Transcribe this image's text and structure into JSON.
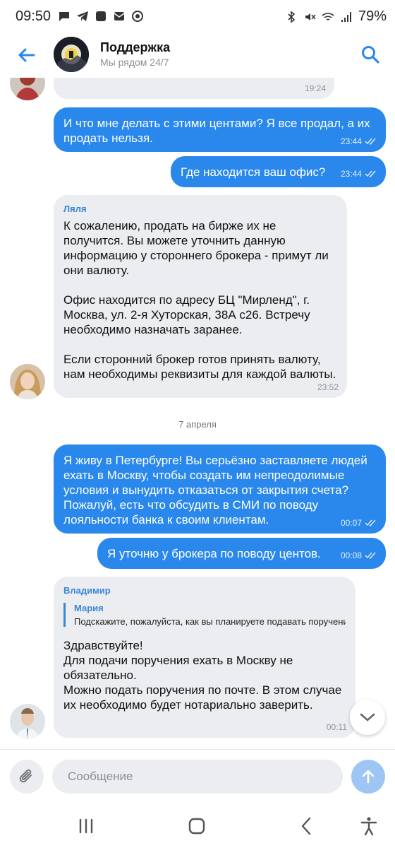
{
  "status_bar": {
    "time": "09:50",
    "battery": "79%"
  },
  "header": {
    "title": "Поддержка",
    "subtitle": "Мы рядом 24/7"
  },
  "messages": {
    "m0": {
      "time": "19:24"
    },
    "m1": {
      "text": "И что мне делать с этими центами? Я все продал, а их продать нельзя.",
      "time": "23:44"
    },
    "m2": {
      "text": "Где находится ваш офис?",
      "time": "23:44"
    },
    "m3": {
      "sender": "Ляля",
      "text": "К сожалению, продать на бирже их не получится. Вы можете уточнить данную информацию у стороннего брокера - примут ли они валюту.\n\nОфис находится по адресу БЦ \"Мирленд\", г. Москва, ул. 2-я Хуторская, 38А с26. Встречу необходимо назначать заранее.\n\nЕсли сторонний брокер готов принять валюту, нам необходимы реквизиты для каждой валюты.",
      "time": "23:52"
    },
    "date_separator": "7 апреля",
    "m4": {
      "text": "Я живу в Петербурге! Вы серьёзно заставляете людей ехать в Москву, чтобы создать им непреодолимые условия и вынудить отказаться от закрытия счета? Пожалуй, есть что обсудить в СМИ по поводу лояльности банка к своим клиентам.",
      "time": "00:07"
    },
    "m5": {
      "text": "Я уточню у брокера по поводу центов.",
      "time": "00:08"
    },
    "m6": {
      "sender": "Владимир",
      "reply_name": "Мария",
      "reply_text": "Подскажите, пожалуйста, как вы планируете подавать поручени",
      "text": "Здравствуйте!\nДля подачи поручения ехать в Москву не обязательно.\nМожно подать поручения по почте. В этом случае их необходимо будет нотариально заверить.",
      "time": "00:11"
    }
  },
  "composer": {
    "placeholder": "Сообщение"
  },
  "colors": {
    "accent": "#2a88ec",
    "incoming_bubble": "#ebedf0",
    "outgoing_bubble": "#2a88ec",
    "send_button": "#9ec6f4"
  },
  "icons": {
    "back": "arrow-left-icon",
    "search": "search-icon",
    "attach": "paperclip-icon",
    "send": "arrow-up-icon",
    "scroll_down": "chevron-down-icon"
  }
}
